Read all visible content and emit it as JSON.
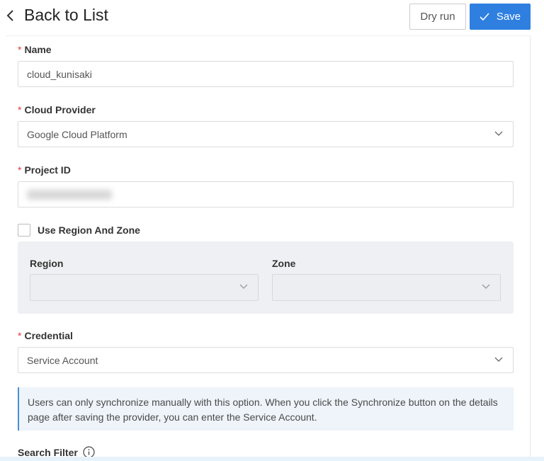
{
  "header": {
    "back_label": "Back to List",
    "dry_run_label": "Dry run",
    "save_label": "Save"
  },
  "form": {
    "name": {
      "label": "Name",
      "value": "cloud_kunisaki"
    },
    "cloud_provider": {
      "label": "Cloud Provider",
      "value": "Google Cloud Platform"
    },
    "project_id": {
      "label": "Project ID"
    },
    "use_region_zone": {
      "label": "Use Region And Zone",
      "checked": false
    },
    "region": {
      "label": "Region"
    },
    "zone": {
      "label": "Zone"
    },
    "credential": {
      "label": "Credential",
      "value": "Service Account"
    },
    "info_text": "Users can only synchronize manually with this option. When you click the Synchronize button on the details page after saving the provider, you can enter the Service Account.",
    "search_filter": {
      "label": "Search Filter"
    }
  },
  "colors": {
    "primary": "#2f7fe0",
    "required": "#e4393c"
  }
}
